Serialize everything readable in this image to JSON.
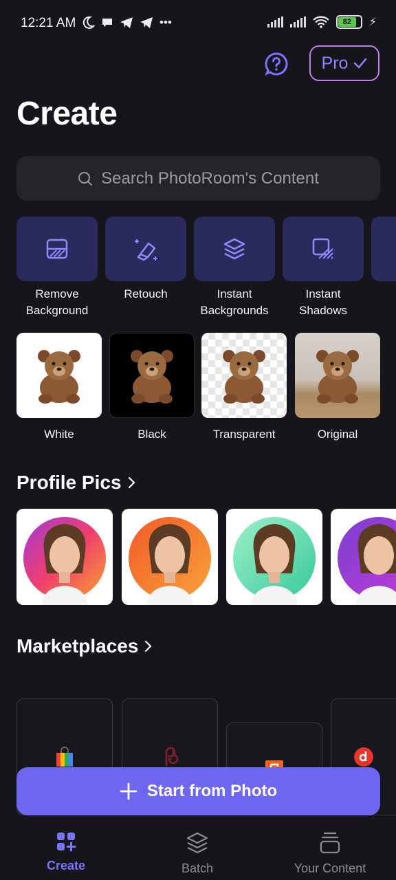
{
  "status_bar": {
    "time": "12:21 AM",
    "battery": "82"
  },
  "header": {
    "title": "Create",
    "pro_label": "Pro"
  },
  "search": {
    "placeholder": "Search PhotoRoom's Content"
  },
  "tools": [
    {
      "label_line1": "Remove",
      "label_line2": "Background",
      "icon": "remove-background-icon"
    },
    {
      "label_line1": "Retouch",
      "label_line2": "",
      "icon": "retouch-eraser-icon"
    },
    {
      "label_line1": "Instant",
      "label_line2": "Backgrounds",
      "icon": "layers-icon"
    },
    {
      "label_line1": "Instant",
      "label_line2": "Shadows",
      "icon": "shadow-icon"
    }
  ],
  "backgrounds": [
    {
      "label": "White"
    },
    {
      "label": "Black"
    },
    {
      "label": "Transparent"
    },
    {
      "label": "Original"
    }
  ],
  "sections": {
    "profile_pics": "Profile Pics",
    "marketplaces": "Marketplaces"
  },
  "start_button": {
    "label": "Start from Photo"
  },
  "bottom_nav": [
    {
      "label": "Create",
      "active": true
    },
    {
      "label": "Batch",
      "active": false
    },
    {
      "label": "Your Content",
      "active": false
    }
  ],
  "colors": {
    "accent": "#6c66f1",
    "tool_bg": "#2b2a5c",
    "background": "#16151b"
  }
}
